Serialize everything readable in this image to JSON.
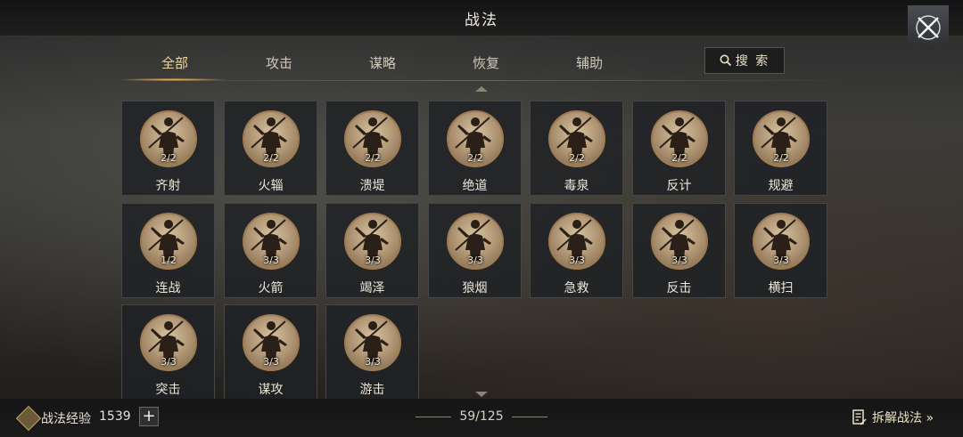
{
  "header": {
    "title": "战法"
  },
  "tabs": [
    {
      "label": "全部",
      "active": true
    },
    {
      "label": "攻击",
      "active": false
    },
    {
      "label": "谋略",
      "active": false
    },
    {
      "label": "恢复",
      "active": false
    },
    {
      "label": "辅助",
      "active": false
    }
  ],
  "search": {
    "label": "搜 索",
    "icon": "search-icon"
  },
  "skills": [
    {
      "name": "齐射",
      "count": "2/2"
    },
    {
      "name": "火辎",
      "count": "2/2"
    },
    {
      "name": "溃堤",
      "count": "2/2"
    },
    {
      "name": "绝道",
      "count": "2/2"
    },
    {
      "name": "毒泉",
      "count": "2/2"
    },
    {
      "name": "反计",
      "count": "2/2"
    },
    {
      "name": "规避",
      "count": "2/2"
    },
    {
      "name": "连战",
      "count": "1/2"
    },
    {
      "name": "火箭",
      "count": "3/3"
    },
    {
      "name": "竭泽",
      "count": "3/3"
    },
    {
      "name": "狼烟",
      "count": "3/3"
    },
    {
      "name": "急救",
      "count": "3/3"
    },
    {
      "name": "反击",
      "count": "3/3"
    },
    {
      "name": "横扫",
      "count": "3/3"
    },
    {
      "name": "突击",
      "count": "3/3"
    },
    {
      "name": "谋攻",
      "count": "3/3"
    },
    {
      "name": "游击",
      "count": "3/3"
    }
  ],
  "footer": {
    "exp_label": "战法经验",
    "exp_value": "1539",
    "plus_label": "+",
    "page": "59/125",
    "decompose_label": "拆解战法 »"
  },
  "colors": {
    "accent": "#f0d79a",
    "card_border": "#454646",
    "portrait_ring": "#9e7b52"
  }
}
